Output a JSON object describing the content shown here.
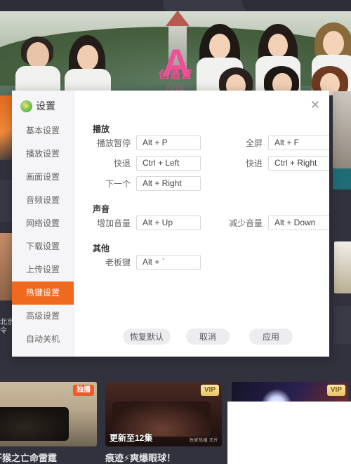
{
  "background": {
    "banner": {
      "show_title": "创造营",
      "show_year": "2020",
      "star_letter": "A"
    },
    "left_sliver_text": "北京\n令",
    "thumbnails": [
      {
        "badge": "独播",
        "badge_type": "exclusive",
        "title": "开猴之亡命雷霆",
        "episode": ""
      },
      {
        "badge": "VIP",
        "badge_type": "vip",
        "title": "痕迹⚡爽爆眼球！",
        "episode": "更新至12集",
        "meta": "独家热播 正片"
      },
      {
        "badge": "VIP",
        "badge_type": "vip",
        "title": "",
        "episode": ""
      }
    ]
  },
  "dialog": {
    "brand_label": "设置",
    "brand_icon": "play-logo-icon",
    "close_icon": "close-icon",
    "sidebar": {
      "items": [
        {
          "label": "基本设置",
          "active": false
        },
        {
          "label": "播放设置",
          "active": false
        },
        {
          "label": "画面设置",
          "active": false
        },
        {
          "label": "音频设置",
          "active": false
        },
        {
          "label": "网络设置",
          "active": false
        },
        {
          "label": "下载设置",
          "active": false
        },
        {
          "label": "上传设置",
          "active": false
        },
        {
          "label": "热键设置",
          "active": true
        },
        {
          "label": "高级设置",
          "active": false
        },
        {
          "label": "自动关机",
          "active": false
        }
      ]
    },
    "sections": {
      "playback": {
        "title": "播放",
        "rows": [
          {
            "label": "播放暂停",
            "value": "Alt + P"
          },
          {
            "label": "全屏",
            "value": "Alt + F"
          },
          {
            "label": "快退",
            "value": "Ctrl + Left"
          },
          {
            "label": "快进",
            "value": "Ctrl + Right"
          },
          {
            "label": "下一个",
            "value": "Alt + Right"
          }
        ]
      },
      "sound": {
        "title": "声音",
        "rows": [
          {
            "label": "增加音量",
            "value": "Alt + Up"
          },
          {
            "label": "减少音量",
            "value": "Alt + Down"
          }
        ]
      },
      "other": {
        "title": "其他",
        "rows": [
          {
            "label": "老板键",
            "value": "Alt + `"
          }
        ]
      }
    },
    "footer": {
      "reset_label": "恢复默认",
      "cancel_label": "取消",
      "apply_label": "应用"
    },
    "colors": {
      "accent": "#ef6a1f",
      "sidebar_bg": "#f5f5f7",
      "dialog_bg": "#ffffff",
      "page_bg": "#32323e"
    }
  }
}
